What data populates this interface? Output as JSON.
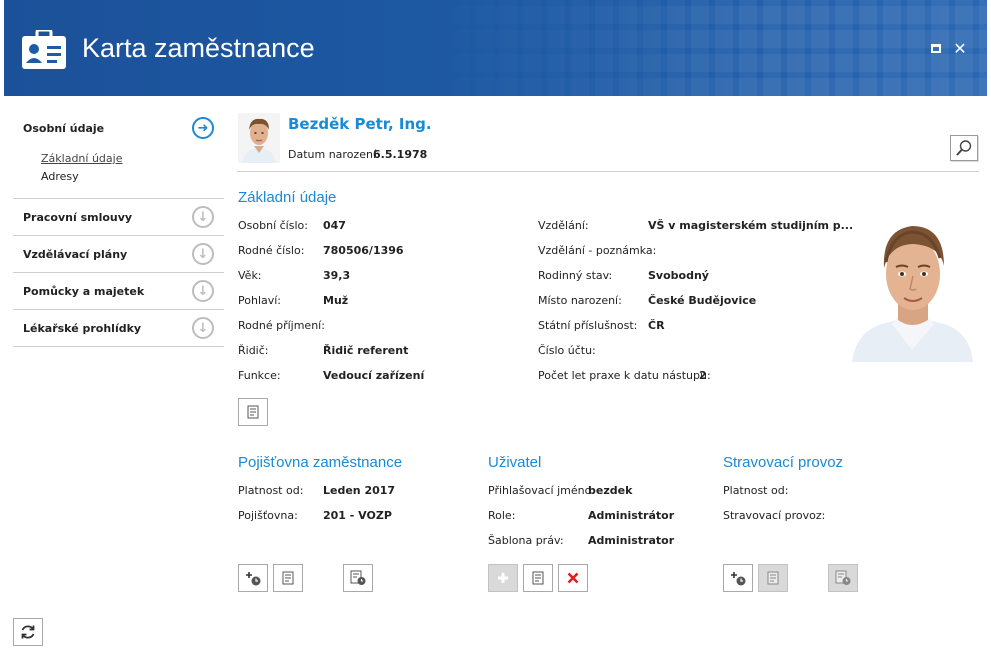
{
  "window": {
    "title": "Karta zaměstnance",
    "colors": {
      "titlebar": "#1e5aa5",
      "accent": "#1a8ad4",
      "delete": "#e02020"
    }
  },
  "sidebar": {
    "sections": [
      {
        "label": "Osobní údaje",
        "expanded": true,
        "icon": "arrow-right-circle-icon",
        "items": [
          {
            "label": "Základní údaje",
            "current": true
          },
          {
            "label": "Adresy"
          }
        ]
      },
      {
        "label": "Pracovní smlouvy",
        "icon": "arrow-down-circle-icon"
      },
      {
        "label": "Vzdělávací plány",
        "icon": "arrow-down-circle-icon"
      },
      {
        "label": "Pomůcky a majetek",
        "icon": "arrow-down-circle-icon"
      },
      {
        "label": "Lékařské prohlídky",
        "icon": "arrow-down-circle-icon"
      }
    ]
  },
  "person": {
    "name": "Bezděk Petr, Ing.",
    "dob_label": "Datum narození:",
    "dob": "6.5.1978"
  },
  "basic": {
    "title": "Základní údaje",
    "left": [
      {
        "label": "Osobní číslo:",
        "value": "047"
      },
      {
        "label": "Rodné číslo:",
        "value": "780506/1396"
      },
      {
        "label": "Věk:",
        "value": "39,3"
      },
      {
        "label": "Pohlaví:",
        "value": "Muž"
      },
      {
        "label": "Rodné příjmení:",
        "value": ""
      },
      {
        "label": "Řidič:",
        "value": "Řidič referent"
      },
      {
        "label": "Funkce:",
        "value": "Vedoucí zařízení"
      }
    ],
    "right": [
      {
        "label": "Vzdělání:",
        "value": "VŠ v magisterském studijním p..."
      },
      {
        "label": "Vzdělání - poznámka:",
        "value": ""
      },
      {
        "label": "Rodinný stav:",
        "value": "Svobodný"
      },
      {
        "label": "Místo narození:",
        "value": "České Budějovice"
      },
      {
        "label": "Státní příslušnost:",
        "value": "ČR"
      },
      {
        "label": "Číslo účtu:",
        "value": ""
      },
      {
        "label": "Počet let praxe k datu nástupu:",
        "value": "2"
      }
    ]
  },
  "insurance": {
    "title": "Pojišťovna zaměstnance",
    "rows": [
      {
        "label": "Platnost od:",
        "value": "Leden 2017"
      },
      {
        "label": "Pojišťovna:",
        "value": "201 - VOZP"
      }
    ]
  },
  "user": {
    "title": "Uživatel",
    "rows": [
      {
        "label": "Přihlašovací jméno:",
        "value": "bezdek"
      },
      {
        "label": "Role:",
        "value": "Administrátor"
      },
      {
        "label": "Šablona práv:",
        "value": "Administrator"
      }
    ]
  },
  "canteen": {
    "title": "Stravovací provoz",
    "rows": [
      {
        "label": "Platnost od:",
        "value": ""
      },
      {
        "label": "Stravovací provoz:",
        "value": ""
      }
    ]
  }
}
